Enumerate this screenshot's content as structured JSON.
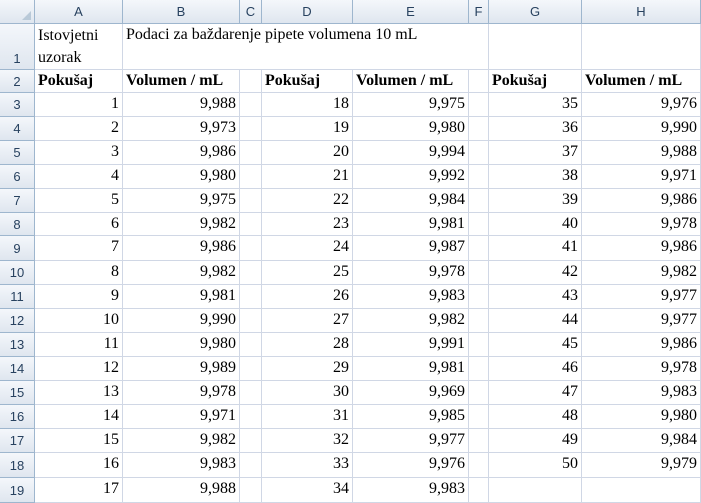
{
  "columns": [
    "A",
    "B",
    "C",
    "D",
    "E",
    "F",
    "G",
    "H"
  ],
  "rows": [
    "1",
    "2",
    "3",
    "4",
    "5",
    "6",
    "7",
    "8",
    "9",
    "10",
    "11",
    "12",
    "13",
    "14",
    "15",
    "16",
    "17",
    "18",
    "19"
  ],
  "title_row": {
    "a1": "Istovjetni uzorak",
    "b1": "Podaci za baždarenje pipete volumena 10 mL"
  },
  "headers": {
    "a": "Pokušaj",
    "b": "Volumen / mL",
    "d": "Pokušaj",
    "e": "Volumen / mL",
    "g": "Pokušaj",
    "h": "Volumen / mL"
  },
  "data": [
    {
      "a": "1",
      "b": "9,988",
      "d": "18",
      "e": "9,975",
      "g": "35",
      "h": "9,976"
    },
    {
      "a": "2",
      "b": "9,973",
      "d": "19",
      "e": "9,980",
      "g": "36",
      "h": "9,990"
    },
    {
      "a": "3",
      "b": "9,986",
      "d": "20",
      "e": "9,994",
      "g": "37",
      "h": "9,988"
    },
    {
      "a": "4",
      "b": "9,980",
      "d": "21",
      "e": "9,992",
      "g": "38",
      "h": "9,971"
    },
    {
      "a": "5",
      "b": "9,975",
      "d": "22",
      "e": "9,984",
      "g": "39",
      "h": "9,986"
    },
    {
      "a": "6",
      "b": "9,982",
      "d": "23",
      "e": "9,981",
      "g": "40",
      "h": "9,978"
    },
    {
      "a": "7",
      "b": "9,986",
      "d": "24",
      "e": "9,987",
      "g": "41",
      "h": "9,986"
    },
    {
      "a": "8",
      "b": "9,982",
      "d": "25",
      "e": "9,978",
      "g": "42",
      "h": "9,982"
    },
    {
      "a": "9",
      "b": "9,981",
      "d": "26",
      "e": "9,983",
      "g": "43",
      "h": "9,977"
    },
    {
      "a": "10",
      "b": "9,990",
      "d": "27",
      "e": "9,982",
      "g": "44",
      "h": "9,977"
    },
    {
      "a": "11",
      "b": "9,980",
      "d": "28",
      "e": "9,991",
      "g": "45",
      "h": "9,986"
    },
    {
      "a": "12",
      "b": "9,989",
      "d": "29",
      "e": "9,981",
      "g": "46",
      "h": "9,978"
    },
    {
      "a": "13",
      "b": "9,978",
      "d": "30",
      "e": "9,969",
      "g": "47",
      "h": "9,983"
    },
    {
      "a": "14",
      "b": "9,971",
      "d": "31",
      "e": "9,985",
      "g": "48",
      "h": "9,980"
    },
    {
      "a": "15",
      "b": "9,982",
      "d": "32",
      "e": "9,977",
      "g": "49",
      "h": "9,984"
    },
    {
      "a": "16",
      "b": "9,983",
      "d": "33",
      "e": "9,976",
      "g": "50",
      "h": "9,979"
    },
    {
      "a": "17",
      "b": "9,988",
      "d": "34",
      "e": "9,983",
      "g": "",
      "h": ""
    }
  ]
}
